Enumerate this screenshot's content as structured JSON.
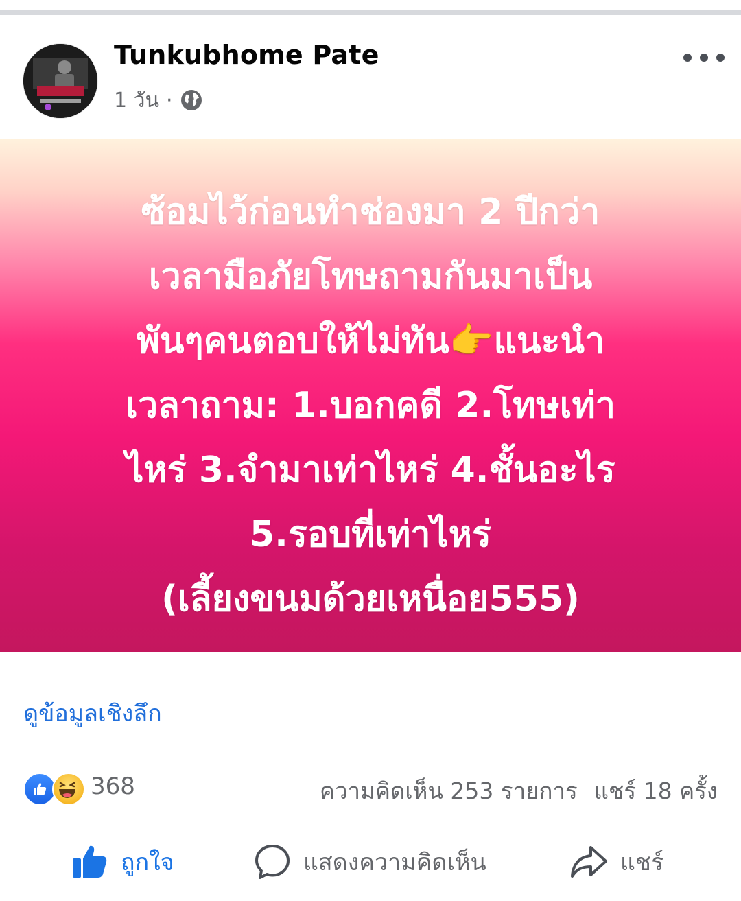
{
  "post": {
    "author": "Tunkubhome Pate",
    "time": "1 วัน",
    "meta_separator": "·",
    "privacy_icon": "globe-icon",
    "more_icon": "more-dots-icon"
  },
  "card": {
    "lines": [
      "ซ้อมไว้ก่อนทำช่องมา 2 ปีกว่า",
      "เวลามือภัยโทษถามกันมาเป็น",
      "พันๆคนตอบให้ไม่ทัน👉แนะนำ",
      "เวลาถาม: 1.บอกคดี 2.โทษเท่า",
      "ไหร่ 3.จำมาเท่าไหร่ 4.ชั้นอะไร",
      "5.รอบที่เท่าไหร่",
      "(เลี้ยงขนมด้วยเหนื่อย555)"
    ],
    "colors": {
      "top": "#fff2dd",
      "middle": "#ff2f80",
      "bottom": "#c4175e",
      "text": "#ffffff"
    }
  },
  "insights_link": "ดูข้อมูลเชิงลึก",
  "stats": {
    "reactions": [
      "like-icon",
      "haha-icon"
    ],
    "reaction_count": "368",
    "comments": "ความคิดเห็น 253 รายการ",
    "shares": "แชร์ 18 ครั้ง"
  },
  "actions": {
    "like": "ถูกใจ",
    "comment": "แสดงความคิดเห็น",
    "share": "แชร์"
  },
  "theme": {
    "link": "#216fdb",
    "like_blue": "#1b74e4",
    "muted": "#65676b"
  }
}
